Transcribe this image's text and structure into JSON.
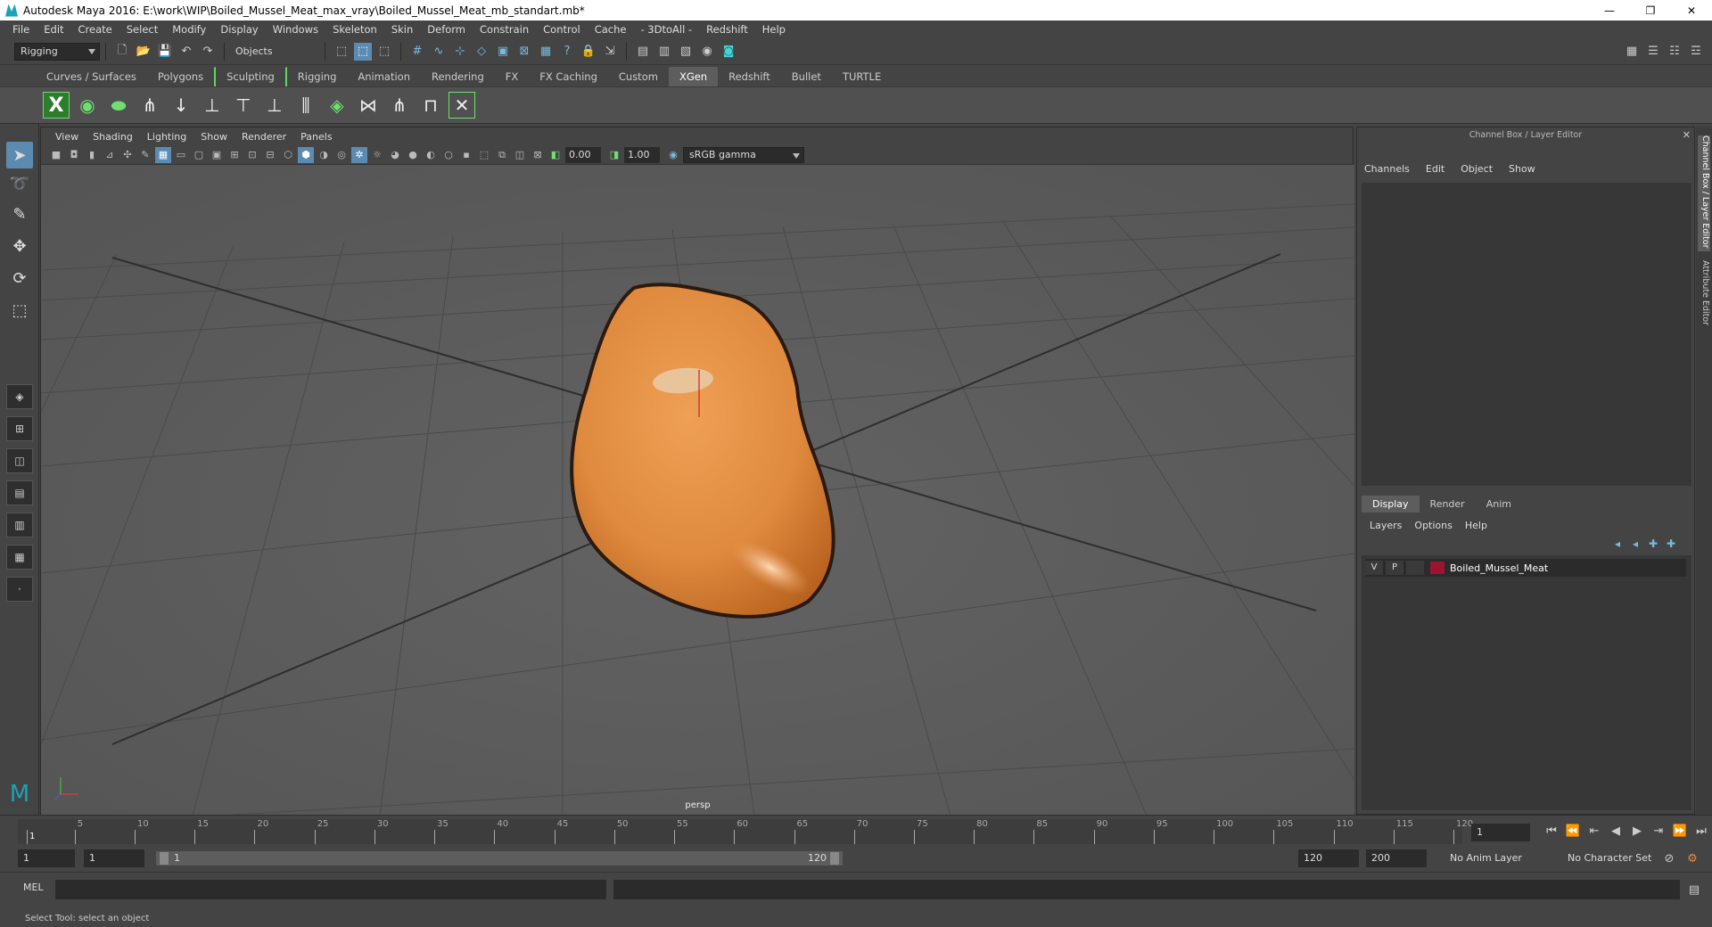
{
  "window": {
    "title": "Autodesk Maya 2016: E:\\work\\WIP\\Boiled_Mussel_Meat_max_vray\\Boiled_Mussel_Meat_mb_standart.mb*",
    "minimize": "—",
    "restore": "❐",
    "close": "✕"
  },
  "menubar": [
    "File",
    "Edit",
    "Create",
    "Select",
    "Modify",
    "Display",
    "Windows",
    "Skeleton",
    "Skin",
    "Deform",
    "Constrain",
    "Control",
    "Cache",
    "- 3DtoAll -",
    "Redshift",
    "Help"
  ],
  "statusline": {
    "menuset": "Rigging",
    "selection_mode": "Objects"
  },
  "shelf_tabs": [
    "Curves / Surfaces",
    "Polygons",
    "Sculpting",
    "Rigging",
    "Animation",
    "Rendering",
    "FX",
    "FX Caching",
    "Custom",
    "XGen",
    "Redshift",
    "Bullet",
    "TURTLE"
  ],
  "active_shelf": "XGen",
  "viewport": {
    "menu": [
      "View",
      "Shading",
      "Lighting",
      "Show",
      "Renderer",
      "Panels"
    ],
    "exposure": "0.00",
    "gamma": "1.00",
    "colorspace": "sRGB gamma",
    "camera": "persp"
  },
  "channel_box": {
    "title": "Channel Box / Layer Editor",
    "menu": [
      "Channels",
      "Edit",
      "Object",
      "Show"
    ],
    "tabs": [
      "Display",
      "Render",
      "Anim"
    ],
    "layer_menu": [
      "Layers",
      "Options",
      "Help"
    ],
    "layers": [
      {
        "visible": "V",
        "playback": "P",
        "name": "Boiled_Mussel_Meat",
        "color": "#9b1530"
      }
    ]
  },
  "side_tabs": [
    "Channel Box / Layer Editor",
    "Attribute Editor"
  ],
  "timeline": {
    "ticks": [
      1,
      5,
      10,
      15,
      20,
      25,
      30,
      35,
      40,
      45,
      50,
      55,
      60,
      65,
      70,
      75,
      80,
      85,
      90,
      95,
      100,
      105,
      110,
      115,
      120
    ],
    "current_frame": "1",
    "playback_buttons": [
      "⏮",
      "⏪",
      "⇤",
      "◀",
      "▶",
      "⇥",
      "⏩",
      "⏭"
    ]
  },
  "range": {
    "start": "1",
    "playback_start": "1",
    "bar_start": "1",
    "bar_end": "120",
    "playback_end": "120",
    "end": "200",
    "anim_layer": "No Anim Layer",
    "character_set": "No Character Set"
  },
  "command": {
    "label": "MEL"
  },
  "helpline": "Select Tool: select an object",
  "colors": {
    "accent": "#5b8bb0",
    "mussel": "#e0893f",
    "layer": "#9b1530"
  }
}
